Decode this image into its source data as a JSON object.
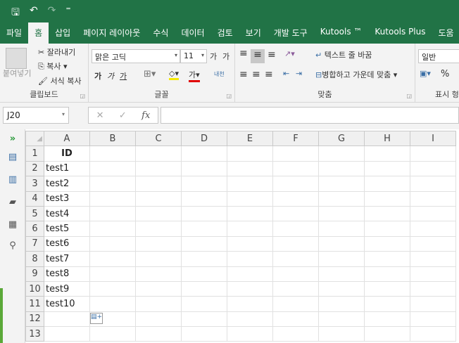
{
  "qat": {
    "save": "🖫",
    "undo": "↶",
    "redo": "↷",
    "customize": "⁼"
  },
  "tabs": [
    "파일",
    "홈",
    "삽입",
    "페이지 레이아웃",
    "수식",
    "데이터",
    "검토",
    "보기",
    "개발 도구",
    "Kutools ™",
    "Kutools Plus",
    "도움"
  ],
  "ribbon": {
    "clipboard": {
      "paste": "붙여넣기",
      "cut": "잘라내기",
      "copy": "복사",
      "format_painter": "서식 복사",
      "label": "클립보드"
    },
    "font": {
      "name": "맑은 고딕",
      "size": "11",
      "grow": "가",
      "shrink": "가",
      "bold": "가",
      "italic": "가",
      "underline": "가",
      "label": "글꼴",
      "font_color": "가",
      "phonetic": "내천"
    },
    "alignment": {
      "wrap": "텍스트 줄 바꿈",
      "merge": "병합하고 가운데 맞춤",
      "label": "맞춤"
    },
    "number": {
      "format": "일반",
      "percent": "%",
      "label": "표시 형"
    }
  },
  "namebox": "J20",
  "formula": {
    "cancel": "✕",
    "enter": "✓",
    "fx": "fx"
  },
  "columns": [
    "A",
    "B",
    "C",
    "D",
    "E",
    "F",
    "G",
    "H",
    "I"
  ],
  "rows": [
    [
      "ID"
    ],
    [
      "test1"
    ],
    [
      "test2"
    ],
    [
      "test3"
    ],
    [
      "test4"
    ],
    [
      "test5"
    ],
    [
      "test6"
    ],
    [
      "test7"
    ],
    [
      "test8"
    ],
    [
      "test9"
    ],
    [
      "test10"
    ],
    [
      ""
    ],
    [
      ""
    ]
  ]
}
